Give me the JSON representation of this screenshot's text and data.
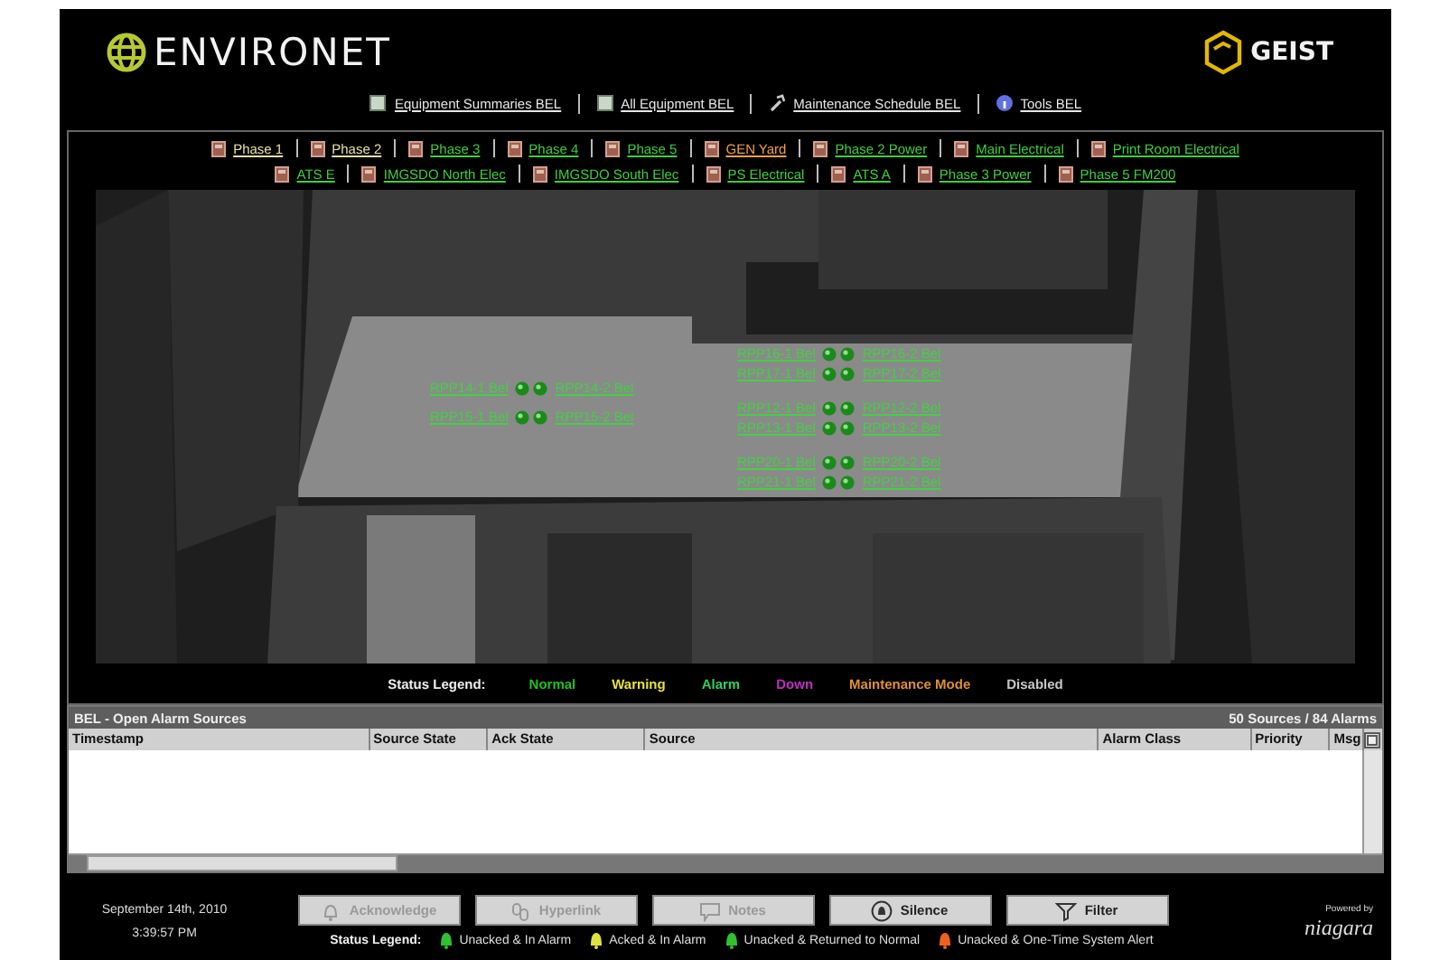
{
  "header": {
    "logo": "ENVIRONET",
    "brand": "GEIST"
  },
  "nav": [
    {
      "label": "Equipment Summaries BEL",
      "kind": "doc"
    },
    {
      "label": "All Equipment BEL",
      "kind": "doc"
    },
    {
      "label": "Maintenance Schedule BEL",
      "kind": "tool"
    },
    {
      "label": "Tools BEL",
      "kind": "info"
    }
  ],
  "tab_rows": [
    [
      {
        "label": "Phase 1",
        "color": "#e8e0a0"
      },
      {
        "label": "Phase 2",
        "color": "#e8e0a0"
      },
      {
        "label": "Phase 3",
        "color": "#3ccf3c"
      },
      {
        "label": "Phase 4",
        "color": "#3ccf3c"
      },
      {
        "label": "Phase 5",
        "color": "#3ccf3c"
      },
      {
        "label": "GEN Yard",
        "color": "#f0a040"
      },
      {
        "label": "Phase 2 Power",
        "color": "#3ccf3c"
      },
      {
        "label": "Main Electrical",
        "color": "#3ccf3c"
      },
      {
        "label": "Print Room Electrical",
        "color": "#3ccf3c"
      }
    ],
    [
      {
        "label": "ATS E",
        "color": "#3ccf3c"
      },
      {
        "label": "IMGSDO North Elec",
        "color": "#3ccf3c"
      },
      {
        "label": "IMGSDO South Elec",
        "color": "#3ccf3c"
      },
      {
        "label": "PS Electrical",
        "color": "#3ccf3c"
      },
      {
        "label": "ATS A",
        "color": "#3ccf3c"
      },
      {
        "label": "Phase 3 Power",
        "color": "#3ccf3c"
      },
      {
        "label": "Phase 5 FM200",
        "color": "#3ccf3c"
      }
    ]
  ],
  "floor_plan": {
    "units": [
      {
        "left": "RPP14-1 Bel",
        "right": "RPP14-2 Bel"
      },
      {
        "left": "RPP15-1 Bel",
        "right": "RPP15-2 Bel"
      },
      {
        "left": "RPP16-1 Bel",
        "right": "RPP16-2 Bel"
      },
      {
        "left": "RPP17-1 Bel",
        "right": "RPP17-2 Bel"
      },
      {
        "left": "RPP12-1 Bel",
        "right": "RPP12-2 Bel"
      },
      {
        "left": "RPP13-1 Bel",
        "right": "RPP13-2 Bel"
      },
      {
        "left": "RPP20-1 Bel",
        "right": "RPP20-2 Bel"
      },
      {
        "left": "RPP21-1 Bel",
        "right": "RPP21-2 Bel"
      }
    ]
  },
  "status_legend": {
    "label": "Status Legend:",
    "items": [
      {
        "label": "Normal",
        "color": "#22c022"
      },
      {
        "label": "Warning",
        "color": "#e8e040"
      },
      {
        "label": "Alarm",
        "color": "#30d060"
      },
      {
        "label": "Down",
        "color": "#c030c0"
      },
      {
        "label": "Maintenance Mode",
        "color": "#e09030"
      },
      {
        "label": "Disabled",
        "color": "#c8c8c8"
      }
    ]
  },
  "alarm_panel": {
    "title": "BEL - Open Alarm Sources",
    "summary": "50 Sources / 84 Alarms",
    "columns": [
      "Timestamp",
      "Source State",
      "Ack State",
      "Source",
      "Alarm Class",
      "Priority",
      "Msg"
    ]
  },
  "clock": {
    "date": "September 14th, 2010",
    "time": "3:39:57 PM"
  },
  "buttons": [
    {
      "label": "Acknowledge",
      "kind": "bell",
      "disabled": true
    },
    {
      "label": "Hyperlink",
      "kind": "link",
      "disabled": true
    },
    {
      "label": "Notes",
      "kind": "note",
      "disabled": true
    },
    {
      "label": "Silence",
      "kind": "silence",
      "disabled": false
    },
    {
      "label": "Filter",
      "kind": "filter",
      "disabled": false
    }
  ],
  "alarm_legend": {
    "label": "Status Legend:",
    "items": [
      {
        "label": "Unacked & In Alarm",
        "color": "#30c030"
      },
      {
        "label": "Acked & In Alarm",
        "color": "#e0e040"
      },
      {
        "label": "Unacked & Returned to Normal",
        "color": "#30c030"
      },
      {
        "label": "Unacked & One-Time System Alert",
        "color": "#f06020"
      }
    ]
  },
  "footer_logo": {
    "tagline": "Powered by",
    "name": "niagara"
  }
}
